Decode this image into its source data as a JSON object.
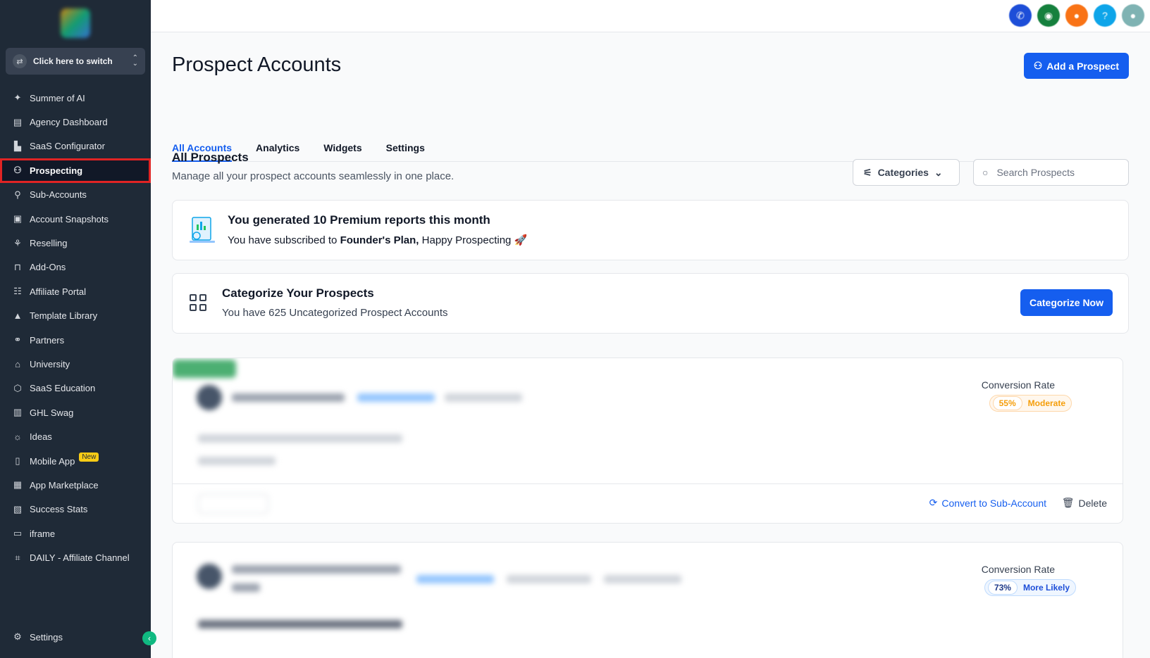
{
  "sidebar": {
    "switcher_label": "Click here to switch",
    "items": [
      {
        "label": "Summer of AI",
        "icon": "sparkles-icon",
        "glyph": "✦"
      },
      {
        "label": "Agency Dashboard",
        "icon": "dashboard-icon",
        "glyph": "▤"
      },
      {
        "label": "SaaS Configurator",
        "icon": "chart-icon",
        "glyph": "▙"
      },
      {
        "label": "Prospecting",
        "icon": "user-search-icon",
        "glyph": "⚇"
      },
      {
        "label": "Sub-Accounts",
        "icon": "user-icon",
        "glyph": "⚲"
      },
      {
        "label": "Account Snapshots",
        "icon": "snapshot-icon",
        "glyph": "▣"
      },
      {
        "label": "Reselling",
        "icon": "reselling-icon",
        "glyph": "⚘"
      },
      {
        "label": "Add-Ons",
        "icon": "bag-icon",
        "glyph": "⊓"
      },
      {
        "label": "Affiliate Portal",
        "icon": "users-icon",
        "glyph": "☷"
      },
      {
        "label": "Template Library",
        "icon": "shapes-icon",
        "glyph": "▲"
      },
      {
        "label": "Partners",
        "icon": "handshake-icon",
        "glyph": "⚭"
      },
      {
        "label": "University",
        "icon": "graduation-cap-icon",
        "glyph": "⌂"
      },
      {
        "label": "SaaS Education",
        "icon": "cube-icon",
        "glyph": "⬡"
      },
      {
        "label": "GHL Swag",
        "icon": "store-icon",
        "glyph": "▥"
      },
      {
        "label": "Ideas",
        "icon": "lightbulb-icon",
        "glyph": "☼"
      },
      {
        "label": "Mobile App",
        "icon": "phone-icon",
        "glyph": "▯",
        "badge": "New"
      },
      {
        "label": "App Marketplace",
        "icon": "grid-icon",
        "glyph": "▦"
      },
      {
        "label": "Success Stats",
        "icon": "stats-icon",
        "glyph": "▧"
      },
      {
        "label": "iframe",
        "icon": "vr-icon",
        "glyph": "▭"
      },
      {
        "label": "DAILY - Affiliate Channel",
        "icon": "frame-icon",
        "glyph": "⌗"
      }
    ],
    "active_index": 3,
    "settings_label": "Settings"
  },
  "header": {
    "title": "Prospect Accounts",
    "add_button": "Add a Prospect"
  },
  "tabs": [
    "All Accounts",
    "Analytics",
    "Widgets",
    "Settings"
  ],
  "active_tab": 0,
  "section": {
    "title": "All Prospects",
    "subtitle": "Manage all your prospect accounts seamlessly in one place.",
    "categories_button": "Categories",
    "search_placeholder": "Search Prospects"
  },
  "report_banner": {
    "title": "You generated 10 Premium reports this month",
    "subtitle_prefix": "You have subscribed to ",
    "plan": "Founder's Plan,",
    "subtitle_suffix": " Happy Prospecting 🚀"
  },
  "categorize_banner": {
    "title": "Categorize Your Prospects",
    "subtitle": "You have 625 Uncategorized Prospect Accounts",
    "button": "Categorize Now"
  },
  "prospects": [
    {
      "conversion_label": "Conversion Rate",
      "rate": "55%",
      "rate_label": "Moderate",
      "convert_label": "Convert to Sub-Account",
      "delete_label": "Delete"
    },
    {
      "conversion_label": "Conversion Rate",
      "rate": "73%",
      "rate_label": "More Likely"
    }
  ],
  "colors": {
    "accent": "#155eef",
    "sidebar_bg": "#1f2a37",
    "active_outline": "#e02424"
  }
}
